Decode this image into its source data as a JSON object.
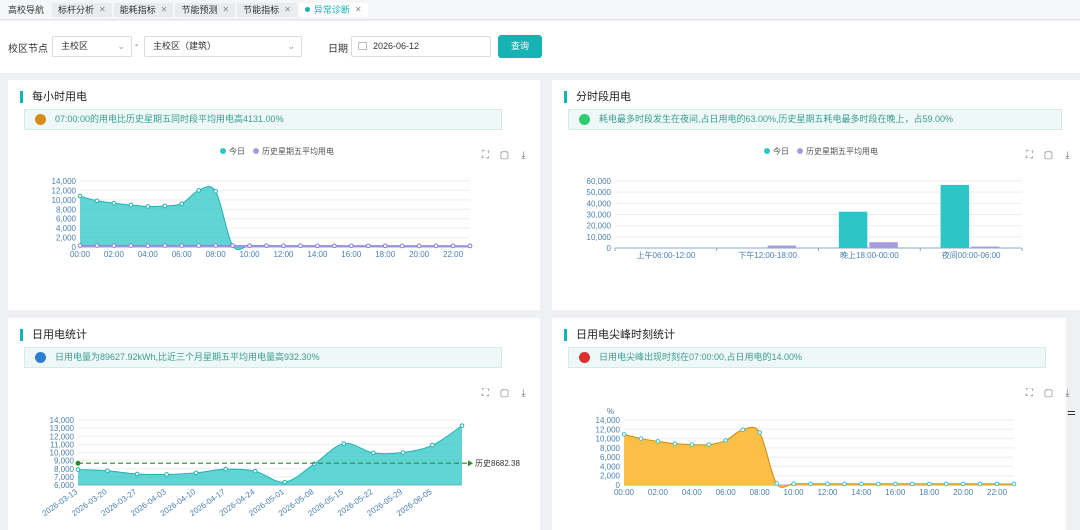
{
  "tabs": [
    {
      "label": "高校导航",
      "closable": false,
      "active": false
    },
    {
      "label": "标杆分析",
      "closable": true,
      "active": false
    },
    {
      "label": "能耗指标",
      "closable": true,
      "active": false
    },
    {
      "label": "节能预测",
      "closable": true,
      "active": false
    },
    {
      "label": "节能指标",
      "closable": true,
      "active": false
    },
    {
      "label": "异常诊断",
      "closable": true,
      "active": true
    }
  ],
  "filters": {
    "campus_label": "校区节点",
    "campus_value": "主校区",
    "separator": "-",
    "building_value": "主校区（建筑）",
    "date_label": "日期",
    "date_value": "2026-06-12",
    "query_label": "查询"
  },
  "panels": {
    "hourly": {
      "title": "每小时用电",
      "info": "07:00:00的用电比历史星期五同时段平均用电高4131.00%",
      "info_color": "#d98a1c"
    },
    "period": {
      "title": "分时段用电",
      "info": "耗电最多时段发生在夜间,占日用电的63.00%,历史星期五耗电最多时段在晚上，占59.00%",
      "info_color": "#2ecc71"
    },
    "daily": {
      "title": "日用电统计",
      "info": "日用电量为89627.92kWh,比近三个月星期五平均用电量高932.30%",
      "info_color": "#2f7fd1"
    },
    "peak": {
      "title": "日用电尖峰时刻统计",
      "info": "日用电尖峰出现时刻在07:00:00,占日用电的14.00%",
      "info_color": "#d93030"
    }
  },
  "legend": {
    "today": "今日",
    "history": "历史星期五平均用电"
  },
  "colors": {
    "accent": "#17b3b3",
    "today": "#2cc6c6",
    "history": "#a99be0",
    "peak_fill": "#fbbc3e",
    "avg_line": "#2a8a2a"
  },
  "toolbox_icons": [
    "zoom-icon",
    "restore-icon",
    "download-icon"
  ],
  "chart_data": [
    {
      "id": "hourly",
      "type": "area",
      "x": [
        "00:00",
        "01:00",
        "02:00",
        "03:00",
        "04:00",
        "05:00",
        "06:00",
        "07:00",
        "08:00",
        "09:00",
        "10:00",
        "11:00",
        "12:00",
        "13:00",
        "14:00",
        "15:00",
        "16:00",
        "17:00",
        "18:00",
        "19:00",
        "20:00",
        "21:00",
        "22:00",
        "23:00"
      ],
      "xticks": [
        "00:00",
        "02:00",
        "04:00",
        "06:00",
        "08:00",
        "10:00",
        "12:00",
        "14:00",
        "16:00",
        "18:00",
        "20:00",
        "22:00"
      ],
      "yticks": [
        "0",
        "2,000",
        "4,000",
        "6,000",
        "8,000",
        "10,000",
        "12,000",
        "14,000"
      ],
      "ylim": [
        0,
        14000
      ],
      "series": [
        {
          "name": "今日",
          "values": [
            10800,
            9800,
            9300,
            8900,
            8600,
            8700,
            9200,
            12000,
            11800,
            300,
            280,
            260,
            250,
            250,
            250,
            240,
            240,
            240,
            240,
            230,
            230,
            230,
            230,
            220
          ]
        },
        {
          "name": "历史星期五平均用电",
          "values": [
            300,
            290,
            290,
            280,
            280,
            280,
            290,
            300,
            310,
            300,
            290,
            280,
            270,
            270,
            270,
            260,
            260,
            260,
            260,
            250,
            250,
            250,
            250,
            240
          ]
        }
      ],
      "legend_position": "top-center"
    },
    {
      "id": "period",
      "type": "bar",
      "categories": [
        "上午06:00-12:00",
        "下午12:00-18:00",
        "晚上18:00-00:00",
        "夜间00:00-06:00"
      ],
      "yticks": [
        "0",
        "10,000",
        "20,000",
        "30,000",
        "40,000",
        "50,000",
        "60,000"
      ],
      "ylim": [
        0,
        60000
      ],
      "series": [
        {
          "name": "今日",
          "values": [
            0,
            0,
            32500,
            56500
          ]
        },
        {
          "name": "历史星期五平均用电",
          "values": [
            0,
            2200,
            5200,
            1300
          ]
        }
      ],
      "legend_position": "top-center"
    },
    {
      "id": "daily",
      "type": "area",
      "x": [
        "2026-03-13",
        "2026-03-20",
        "2026-03-27",
        "2026-04-03",
        "2026-04-10",
        "2026-04-17",
        "2026-04-24",
        "2026-05-01",
        "2026-05-08",
        "2026-05-15",
        "2026-05-22",
        "2026-05-29",
        "2026-06-05",
        "2026-06-12"
      ],
      "xticks": [
        "2026-03-13",
        "2026-03-20",
        "2026-03-27",
        "2026-04-03",
        "2026-04-10",
        "2026-04-17",
        "2026-04-24",
        "2026-05-01",
        "2026-05-08",
        "2026-05-15",
        "2026-05-22",
        "2026-05-29",
        "2026-06-05"
      ],
      "yticks": [
        "6,000",
        "7,000",
        "8,000",
        "9,000",
        "10,000",
        "11,000",
        "12,000",
        "13,000",
        "14,000"
      ],
      "ylim": [
        6000,
        14000
      ],
      "series": [
        {
          "name": "日用电",
          "values": [
            7900,
            7750,
            7350,
            7300,
            7500,
            7950,
            7700,
            6350,
            8600,
            11100,
            9950,
            10000,
            10900,
            13300
          ]
        }
      ],
      "average": {
        "label": "历史8682.38",
        "value": 8682.38
      }
    },
    {
      "id": "peak",
      "type": "area",
      "x": [
        "00:00",
        "01:00",
        "02:00",
        "03:00",
        "04:00",
        "05:00",
        "06:00",
        "07:00",
        "08:00",
        "09:00",
        "10:00",
        "11:00",
        "12:00",
        "13:00",
        "14:00",
        "15:00",
        "16:00",
        "17:00",
        "18:00",
        "19:00",
        "20:00",
        "21:00",
        "22:00",
        "23:00"
      ],
      "xticks": [
        "00:00",
        "02:00",
        "04:00",
        "06:00",
        "08:00",
        "10:00",
        "12:00",
        "14:00",
        "16:00",
        "18:00",
        "20:00",
        "22:00"
      ],
      "yticks": [
        "0",
        "2,000",
        "4,000",
        "6,000",
        "8,000",
        "10,000",
        "12,000",
        "14,000"
      ],
      "ylim": [
        0,
        14000
      ],
      "yunit": "%",
      "series": [
        {
          "name": "日用电",
          "values": [
            10900,
            10000,
            9400,
            8900,
            8700,
            8700,
            9600,
            11900,
            11300,
            300,
            280,
            260,
            250,
            250,
            250,
            240,
            240,
            240,
            240,
            230,
            230,
            230,
            230,
            220
          ]
        }
      ]
    }
  ]
}
